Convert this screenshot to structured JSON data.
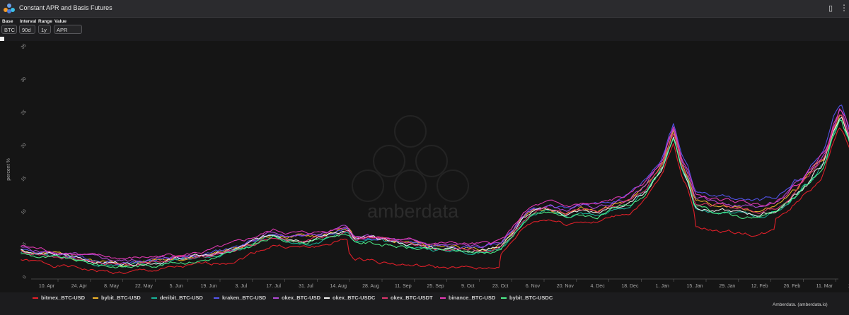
{
  "app": {
    "title": "Constant APR and Basis Futures"
  },
  "controls": [
    {
      "label": "Base",
      "value": "BTC"
    },
    {
      "label": "Interval",
      "value": "90d"
    },
    {
      "label": "Range",
      "value": "1y"
    },
    {
      "label": "Value",
      "value": "APR"
    }
  ],
  "watermark": "amberdata",
  "credit": "Amberdata. (amberdata.io)",
  "chart_data": {
    "type": "line",
    "title": "",
    "xlabel": "",
    "ylabel": "percent %",
    "ylim": [
      0,
      35
    ],
    "yticks": [
      0,
      5,
      10,
      15,
      20,
      25,
      30,
      35
    ],
    "xtick_labels": [
      "10. Apr",
      "24. Apr",
      "8. May",
      "22. May",
      "5. Jun",
      "19. Jun",
      "3. Jul",
      "17. Jul",
      "31. Jul",
      "14. Aug",
      "28. Aug",
      "11. Sep",
      "25. Sep",
      "9. Oct",
      "23. Oct",
      "6. Nov",
      "20. Nov",
      "4. Dec",
      "18. Dec",
      "1. Jan",
      "15. Jan",
      "29. Jan",
      "12. Feb",
      "26. Feb",
      "11. Mar",
      "25. Mar"
    ],
    "grid": false,
    "legend_position": "bottom",
    "base_series": {
      "name": "composite",
      "description_units": "x = tick index (0 = 10. Apr, 1 = 24. Apr, ... 25 = 25. Mar), y = percent",
      "points": [
        [
          -0.8,
          4.3
        ],
        [
          -0.5,
          4.0
        ],
        [
          0,
          3.6
        ],
        [
          0.5,
          3.4
        ],
        [
          1,
          3.0
        ],
        [
          1.5,
          2.6
        ],
        [
          2,
          2.4
        ],
        [
          2.5,
          2.3
        ],
        [
          3,
          2.5
        ],
        [
          3.5,
          2.7
        ],
        [
          4,
          3.0
        ],
        [
          4.5,
          3.2
        ],
        [
          5,
          3.5
        ],
        [
          5.5,
          4.0
        ],
        [
          6,
          4.6
        ],
        [
          6.5,
          5.7
        ],
        [
          7,
          6.6
        ],
        [
          7.5,
          6.3
        ],
        [
          8,
          6.1
        ],
        [
          8.5,
          6.4
        ],
        [
          9,
          7.1
        ],
        [
          9.3,
          7.4
        ],
        [
          9.5,
          5.8
        ],
        [
          10,
          5.9
        ],
        [
          10.5,
          5.6
        ],
        [
          11,
          5.2
        ],
        [
          11.5,
          4.9
        ],
        [
          12,
          4.7
        ],
        [
          12.5,
          4.6
        ],
        [
          13,
          4.5
        ],
        [
          13.5,
          4.4
        ],
        [
          14,
          5.0
        ],
        [
          14.3,
          6.5
        ],
        [
          14.7,
          9.0
        ],
        [
          15,
          10.0
        ],
        [
          15.5,
          10.5
        ],
        [
          16,
          9.8
        ],
        [
          16.5,
          10.3
        ],
        [
          17,
          10.0
        ],
        [
          17.5,
          10.8
        ],
        [
          18,
          11.5
        ],
        [
          18.5,
          13.5
        ],
        [
          19,
          17.0
        ],
        [
          19.2,
          20.0
        ],
        [
          19.35,
          22.0
        ],
        [
          19.6,
          17.0
        ],
        [
          19.8,
          15.0
        ],
        [
          20,
          11.5
        ],
        [
          20.5,
          10.8
        ],
        [
          21,
          10.5
        ],
        [
          21.5,
          10.2
        ],
        [
          22,
          10.0
        ],
        [
          22.5,
          10.6
        ],
        [
          23,
          12.5
        ],
        [
          23.5,
          15.0
        ],
        [
          24,
          18.0
        ],
        [
          24.3,
          22.5
        ],
        [
          24.5,
          25.0
        ],
        [
          24.8,
          21.0
        ],
        [
          25.0,
          23.0
        ],
        [
          25.3,
          21.0
        ],
        [
          25.6,
          24.0
        ],
        [
          25.8,
          26.0
        ]
      ]
    },
    "series": [
      {
        "name": "bitmex_BTC-USD",
        "color": "#e8202a",
        "offset": -1.5,
        "late_offset": -1.6,
        "seed": 1
      },
      {
        "name": "bybit_BTC-USD",
        "color": "#f2b52a",
        "offset": 0.1,
        "late_offset": 0.2,
        "seed": 2
      },
      {
        "name": "deribit_BTC-USD",
        "color": "#17b59a",
        "offset": -0.3,
        "late_offset": -0.6,
        "seed": 3
      },
      {
        "name": "kraken_BTC-USD",
        "color": "#5555f0",
        "offset": 0.2,
        "late_offset": 1.6,
        "seed": 4
      },
      {
        "name": "okex_BTC-USD",
        "color": "#b24ad8",
        "offset": 0.3,
        "late_offset": 0.8,
        "seed": 5
      },
      {
        "name": "okex_BTC-USDC",
        "color": "#f2f2f2",
        "offset": 0.0,
        "late_offset": -0.4,
        "seed": 6
      },
      {
        "name": "okex_BTC-USDT",
        "color": "#e0356e",
        "offset": -0.1,
        "late_offset": 0.3,
        "seed": 7
      },
      {
        "name": "binance_BTC-USD",
        "color": "#e83ab8",
        "offset": 0.6,
        "late_offset": 1.2,
        "seed": 8
      },
      {
        "name": "bybit_BTC-USDC",
        "color": "#4ef08a",
        "offset": -0.5,
        "late_offset": -0.8,
        "seed": 9
      }
    ]
  }
}
